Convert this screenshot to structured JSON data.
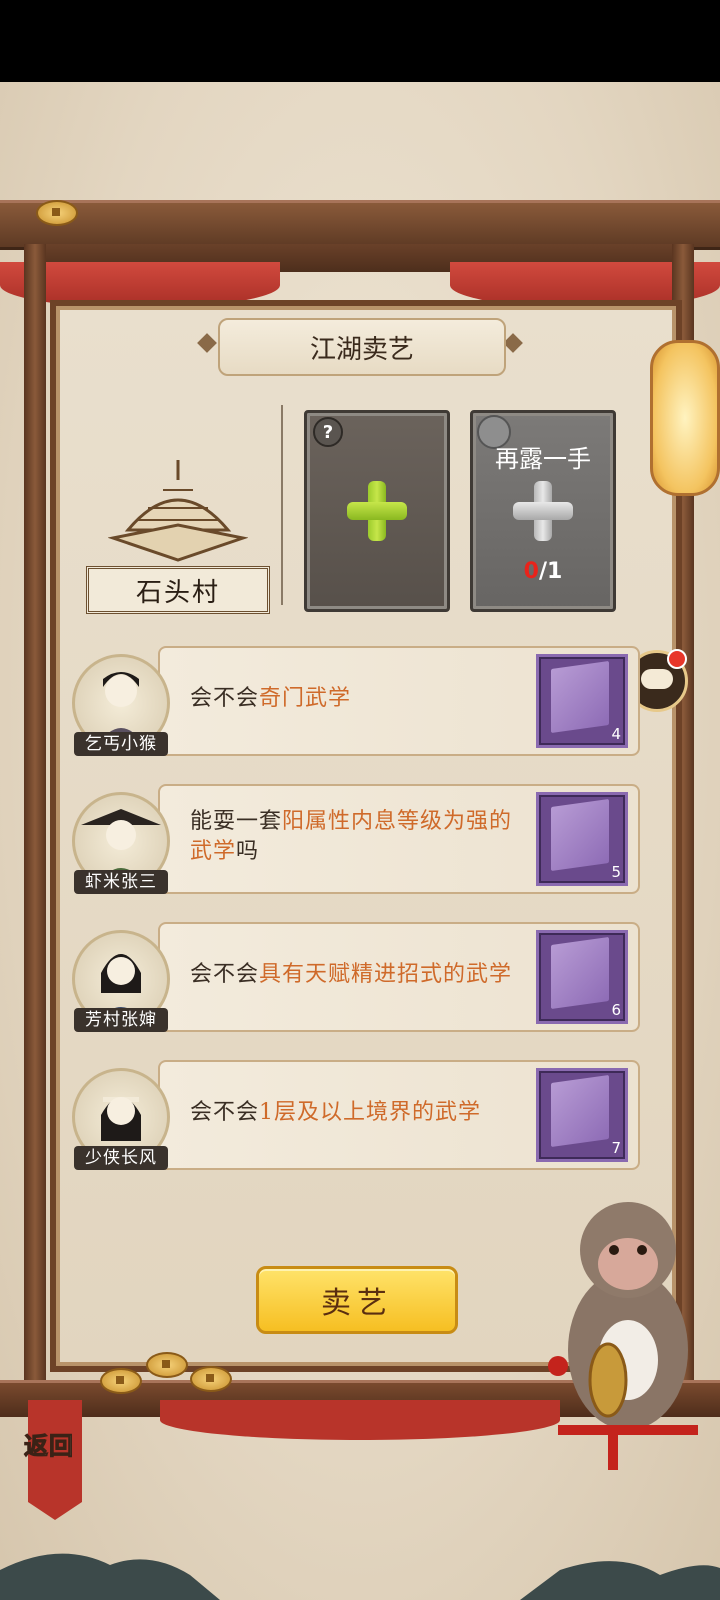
{
  "title": "江湖卖艺",
  "village": {
    "name": "石头村"
  },
  "slots": [
    {
      "badge": "?",
      "kind": "add"
    },
    {
      "title": "再露一手",
      "count_current": "0",
      "count_total": "/1",
      "kind": "locked"
    }
  ],
  "requests": [
    {
      "npc": "乞丐小猴",
      "text_plain": "会不会",
      "text_highlight": "奇门武学",
      "text_tail": "",
      "reward_count": "4"
    },
    {
      "npc": "虾米张三",
      "text_plain": "能耍一套",
      "text_highlight": "阳属性内息等级为强的武学",
      "text_tail": "吗",
      "reward_count": "5"
    },
    {
      "npc": "芳村张婶",
      "text_plain": "会不会",
      "text_highlight": "具有天赋精进招式的武学",
      "text_tail": "",
      "reward_count": "6"
    },
    {
      "npc": "少侠长风",
      "text_plain": "会不会",
      "text_highlight": "1层及以上境界的武学",
      "text_tail": "",
      "reward_count": "7"
    }
  ],
  "actions": {
    "sell": "卖艺",
    "back": "返回"
  },
  "colors": {
    "highlight": "#cf6a2a",
    "button": "#f6bf22",
    "frame": "#6d4227"
  },
  "icons": [
    "question-icon",
    "plus-icon",
    "lock-icon",
    "chat-icon",
    "book-icon",
    "back-arrow-icon",
    "coin-icon"
  ]
}
